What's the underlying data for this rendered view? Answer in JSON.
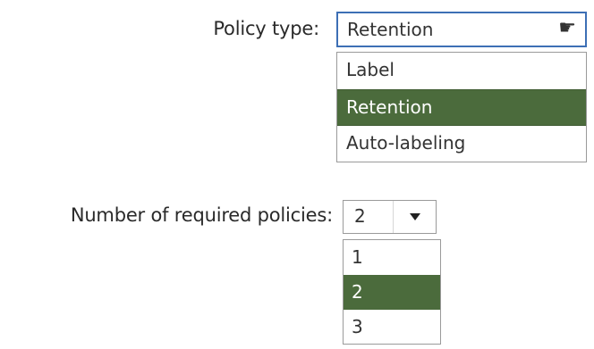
{
  "policy_type": {
    "label": "Policy type:",
    "selected_value": "Retention",
    "cursor_icon": "hand-pointer-icon",
    "options": [
      {
        "label": "Label",
        "selected": false
      },
      {
        "label": "Retention",
        "selected": true
      },
      {
        "label": "Auto-labeling",
        "selected": false
      }
    ]
  },
  "required_policies": {
    "label": "Number of required policies:",
    "selected_value": "2",
    "options": [
      {
        "label": "1",
        "selected": false
      },
      {
        "label": "2",
        "selected": true
      },
      {
        "label": "3",
        "selected": false
      }
    ]
  },
  "colors": {
    "selected_bg": "#4b6b3c",
    "focus_border": "#3d6fb5"
  }
}
